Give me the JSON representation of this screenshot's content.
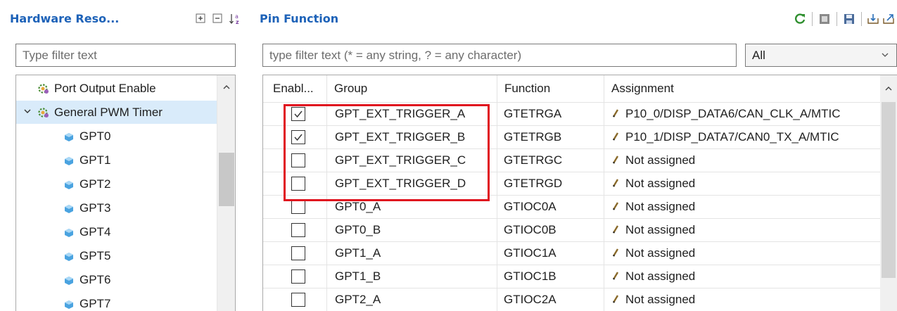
{
  "left_view": {
    "title": "Hardware Reso...",
    "tools": [
      {
        "icon": "expand-all-icon"
      },
      {
        "icon": "collapse-all-icon"
      },
      {
        "icon": "sort-alphabetical-icon"
      }
    ],
    "filter_placeholder": "Type filter text",
    "tree": [
      {
        "label": "Port Output Enable",
        "icon": "gear-icon",
        "level": 1,
        "expanded": null,
        "selected": false
      },
      {
        "label": "General PWM Timer",
        "icon": "gear-icon",
        "level": 1,
        "expanded": true,
        "selected": true
      },
      {
        "label": "GPT0",
        "icon": "cube-icon",
        "level": 2
      },
      {
        "label": "GPT1",
        "icon": "cube-icon",
        "level": 2
      },
      {
        "label": "GPT2",
        "icon": "cube-icon",
        "level": 2
      },
      {
        "label": "GPT3",
        "icon": "cube-icon",
        "level": 2
      },
      {
        "label": "GPT4",
        "icon": "cube-icon",
        "level": 2
      },
      {
        "label": "GPT5",
        "icon": "cube-icon",
        "level": 2
      },
      {
        "label": "GPT6",
        "icon": "cube-icon",
        "level": 2
      },
      {
        "label": "GPT7",
        "icon": "cube-icon",
        "level": 2
      }
    ]
  },
  "right_view": {
    "title": "Pin Function",
    "tools": [
      {
        "icon": "refresh-icon"
      },
      {
        "icon": "chip-icon"
      },
      {
        "icon": "save-icon"
      },
      {
        "icon": "import-icon"
      },
      {
        "icon": "export-icon"
      }
    ],
    "filter_placeholder": "type filter text (* = any string, ? = any character)",
    "combo_value": "All",
    "columns": [
      "Enabl...",
      "Group",
      "Function",
      "Assignment"
    ],
    "rows": [
      {
        "enabled": true,
        "group": "GPT_EXT_TRIGGER_A",
        "function": "GTETRGA",
        "assignment": "P10_0/DISP_DATA6/CAN_CLK_A/MTIC"
      },
      {
        "enabled": true,
        "group": "GPT_EXT_TRIGGER_B",
        "function": "GTETRGB",
        "assignment": "P10_1/DISP_DATA7/CAN0_TX_A/MTIC"
      },
      {
        "enabled": false,
        "group": "GPT_EXT_TRIGGER_C",
        "function": "GTETRGC",
        "assignment": "Not assigned"
      },
      {
        "enabled": false,
        "group": "GPT_EXT_TRIGGER_D",
        "function": "GTETRGD",
        "assignment": "Not assigned"
      },
      {
        "enabled": false,
        "group": "GPT0_A",
        "function": "GTIOC0A",
        "assignment": "Not assigned"
      },
      {
        "enabled": false,
        "group": "GPT0_B",
        "function": "GTIOC0B",
        "assignment": "Not assigned"
      },
      {
        "enabled": false,
        "group": "GPT1_A",
        "function": "GTIOC1A",
        "assignment": "Not assigned"
      },
      {
        "enabled": false,
        "group": "GPT1_B",
        "function": "GTIOC1B",
        "assignment": "Not assigned"
      },
      {
        "enabled": false,
        "group": "GPT2_A",
        "function": "GTIOC2A",
        "assignment": "Not assigned"
      }
    ]
  },
  "colors": {
    "view_title": "#1d62b8",
    "selection": "#d9ebfa",
    "highlight_box": "#e0121e"
  }
}
